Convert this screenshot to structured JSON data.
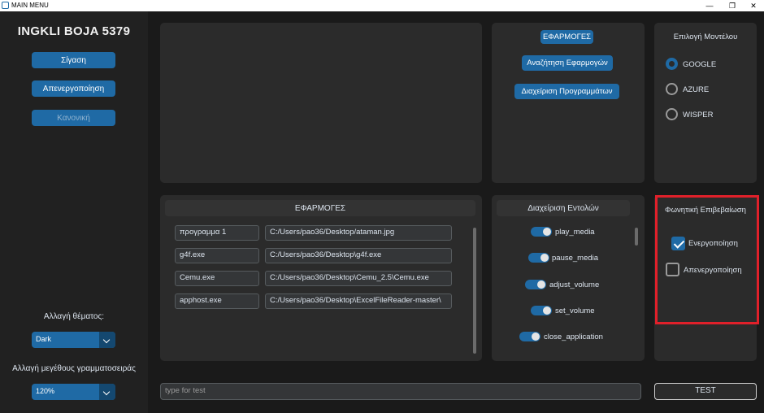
{
  "window": {
    "title": "MAIN MENU",
    "minimize_glyph": "—",
    "maximize_glyph": "❐",
    "close_glyph": "✕"
  },
  "sidebar": {
    "logo": "INGKLI BOJA 5379",
    "buttons": {
      "mute": "Σίγαση",
      "disable": "Απενεργοποίηση",
      "normal": "Κανονική"
    },
    "theme_label": "Αλλαγή θέματος:",
    "theme_value": "Dark",
    "font_size_label": "Αλλαγή μεγέθους γραμματοσειράς",
    "font_size_value": "120%"
  },
  "apps_top": {
    "label": "ΕΦΑΡΜΟΓΕΣ",
    "search_button": "Αναζήτηση Εφαρμογών",
    "manage_button": "Διαχείριση Προγραμμάτων"
  },
  "model": {
    "title": "Επιλογή Μοντέλου",
    "options": [
      "GOOGLE",
      "AZURE",
      "WISPER"
    ],
    "selected": "GOOGLE"
  },
  "apps_list": {
    "header": "ΕΦΑΡΜΟΓΕΣ",
    "rows": [
      {
        "name": "προγραμμα 1",
        "path": "C:/Users/pao36/Desktop/ataman.jpg"
      },
      {
        "name": "g4f.exe",
        "path": "C:/Users/pao36/Desktop\\g4f.exe"
      },
      {
        "name": "Cemu.exe",
        "path": "C:/Users/pao36/Desktop\\Cemu_2.5\\Cemu.exe"
      },
      {
        "name": "apphost.exe",
        "path": "C:/Users/pao36/Desktop\\ExcelFileReader-master\\"
      }
    ]
  },
  "commands": {
    "header": "Διαχείριση Εντολών",
    "items": [
      "play_media",
      "pause_media",
      "adjust_volume",
      "set_volume",
      "close_application"
    ]
  },
  "voice_confirm": {
    "title": "Φωνητική Επιβεβαίωση",
    "enable": "Ενεργοποίηση",
    "disable": "Απενεργοποίηση",
    "enabled": true,
    "highlight_color": "#e0202a"
  },
  "bottom": {
    "test_placeholder": "type for test",
    "test_button": "TEST"
  },
  "colors": {
    "accent": "#1f6aa5",
    "background": "#1a1a1a",
    "panel": "#2b2b2b"
  }
}
